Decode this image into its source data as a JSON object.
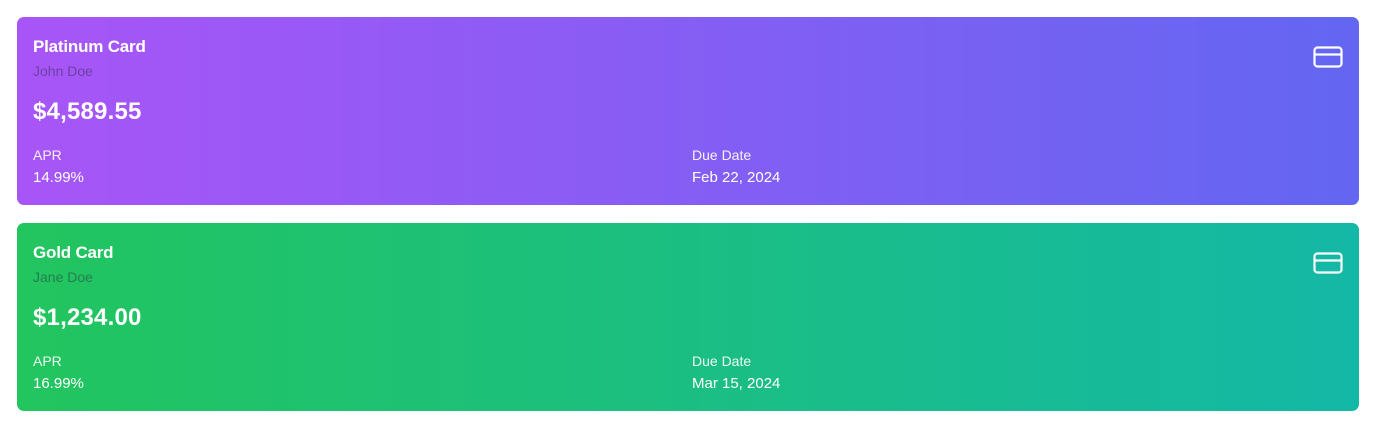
{
  "cards": [
    {
      "name": "Platinum Card",
      "holder": "John Doe",
      "balance": "$4,589.55",
      "apr_label": "APR",
      "apr_value": "14.99%",
      "due_label": "Due Date",
      "due_value": "Feb 22, 2024",
      "icon": "credit-card-icon",
      "gradient": [
        "#a855f7",
        "#6366f1"
      ]
    },
    {
      "name": "Gold Card",
      "holder": "Jane Doe",
      "balance": "$1,234.00",
      "apr_label": "APR",
      "apr_value": "16.99%",
      "due_label": "Due Date",
      "due_value": "Mar 15, 2024",
      "icon": "credit-card-icon",
      "gradient": [
        "#22c55e",
        "#14b8a6"
      ]
    }
  ]
}
